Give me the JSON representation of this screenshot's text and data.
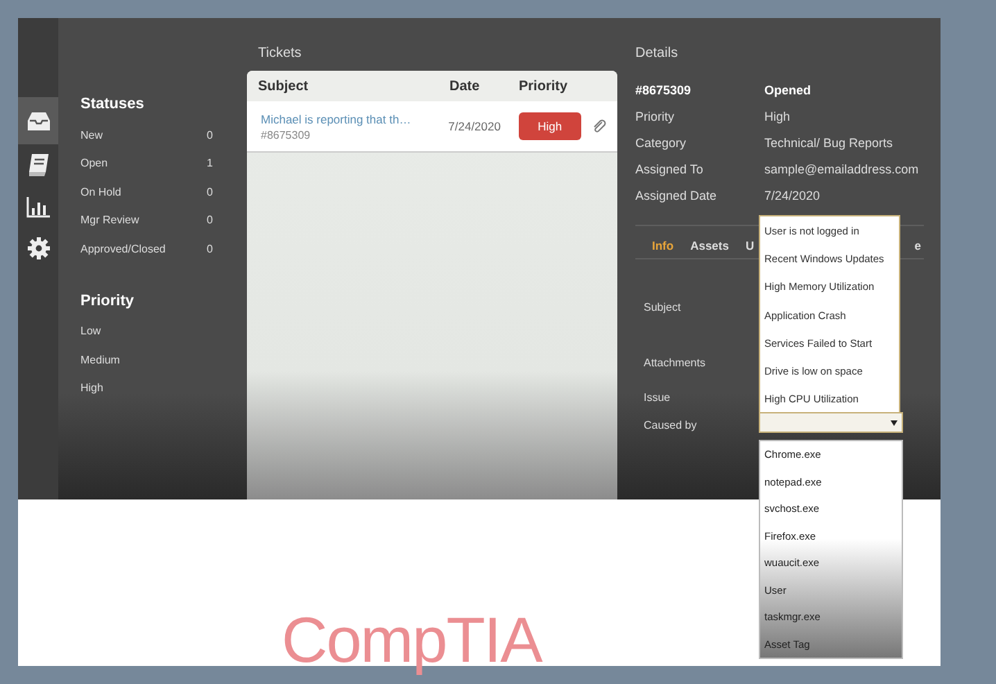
{
  "nav_icons": [
    {
      "kind": "inbox",
      "selected": true
    },
    {
      "kind": "book",
      "selected": false
    },
    {
      "kind": "chart",
      "selected": false
    },
    {
      "kind": "settings",
      "selected": false
    }
  ],
  "sidebar": {
    "statuses_title": "Statuses",
    "statuses": [
      {
        "label": "New",
        "count": "0"
      },
      {
        "label": "Open",
        "count": "1"
      },
      {
        "label": "On Hold",
        "count": "0"
      },
      {
        "label": "Mgr Review",
        "count": "0"
      },
      {
        "label": "Approved/Closed",
        "count": "0"
      }
    ],
    "priority_title": "Priority",
    "priorities": [
      "Low",
      "Medium",
      "High"
    ]
  },
  "tickets": {
    "title": "Tickets",
    "columns": [
      "Subject",
      "Date",
      "Priority"
    ],
    "rows": [
      {
        "subject": "Michael is reporting that th…",
        "id": "#8675309",
        "date": "7/24/2020",
        "priority": "High",
        "attachment": true
      }
    ]
  },
  "details": {
    "title": "Details",
    "header": {
      "id": "#8675309",
      "status": "Opened"
    },
    "fields": [
      {
        "label": "Priority",
        "value": "High"
      },
      {
        "label": "Category",
        "value": "Technical/ Bug Reports"
      },
      {
        "label": "Assigned To",
        "value": "sample@emailaddress.com"
      },
      {
        "label": "Assigned Date",
        "value": "7/24/2020"
      }
    ],
    "tabs": [
      {
        "label": "Info",
        "selected": true
      },
      {
        "label": "Assets",
        "selected": false
      },
      {
        "label": "U",
        "selected": false
      },
      {
        "label": "e",
        "selected": false
      }
    ],
    "form_labels": [
      "Subject",
      "Attachments",
      "Issue",
      "Caused by"
    ],
    "issue_dropdown": {
      "expanded": true,
      "options": [
        "User is not logged in",
        "Recent Windows Updates",
        "High Memory Utilization",
        "Application Crash",
        "Services Failed to Start",
        "Drive is low on space",
        "High CPU Utilization"
      ]
    },
    "caused_by_list": {
      "options": [
        "Chrome.exe",
        "notepad.exe",
        "svchost.exe",
        "Firefox.exe",
        "wuaucit.exe",
        "User",
        "taskmgr.exe",
        "Asset Tag"
      ]
    }
  },
  "logo": {
    "text": "CompTIA"
  }
}
